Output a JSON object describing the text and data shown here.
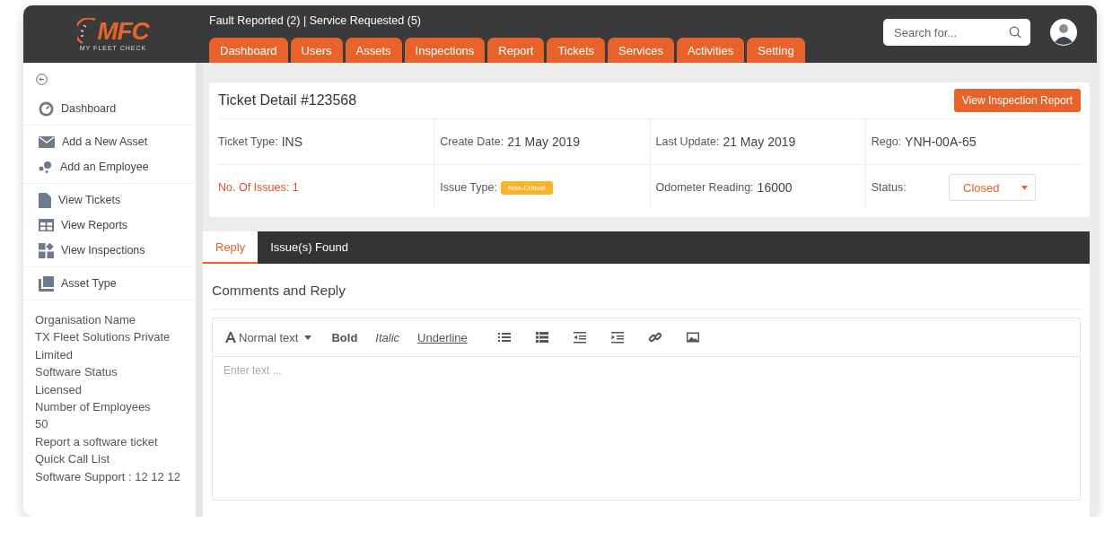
{
  "logo": {
    "text": "MFC",
    "caption": "MY FLEET CHECK"
  },
  "header": {
    "notice": "Fault Reported (2) | Service Requested (5)",
    "tabs": [
      {
        "label": "Dashboard",
        "selected": false
      },
      {
        "label": "Users",
        "selected": false
      },
      {
        "label": "Assets",
        "selected": false
      },
      {
        "label": "Inspections",
        "selected": false
      },
      {
        "label": "Report",
        "selected": false
      },
      {
        "label": "Tickets",
        "selected": false
      },
      {
        "label": "Services",
        "selected": false
      },
      {
        "label": "Activities",
        "selected": false
      },
      {
        "label": "Setting",
        "selected": false
      }
    ],
    "search": {
      "placeholder": "Search for..."
    }
  },
  "sidebar": {
    "groups": [
      {
        "items": [
          {
            "label": "Dashboard"
          }
        ]
      },
      {
        "items": [
          {
            "label": "Add a New Asset"
          },
          {
            "label": "Add an Employee"
          }
        ]
      },
      {
        "items": [
          {
            "label": "View Tickets"
          },
          {
            "label": "View Reports"
          },
          {
            "label": "View Inspections"
          }
        ]
      },
      {
        "items": [
          {
            "label": "Asset Type"
          }
        ]
      }
    ],
    "info": [
      "Organisation Name",
      "TX Fleet Solutions Private Limited",
      "Software Status",
      "Licensed",
      "Number of Employees",
      "50",
      "Report a software ticket",
      "Quick Call List",
      "Software Support : 12 12 12"
    ]
  },
  "ticket": {
    "title": "Ticket Detail #123568",
    "action": "View Inspection Report",
    "rows": [
      [
        {
          "kind": "text",
          "label": "Ticket Type:",
          "value": "INS"
        },
        {
          "kind": "text",
          "label": "Create Date:",
          "value": "21 May 2019"
        },
        {
          "kind": "text",
          "label": "Last Update:",
          "value": "21 May 2019"
        },
        {
          "kind": "text",
          "label": "Rego:",
          "value": "YNH-00A-65"
        }
      ],
      [
        {
          "kind": "alert",
          "label": "No. Of Issues: 1"
        },
        {
          "kind": "badge",
          "label": "Issue Type:",
          "value": "Non-Critical"
        },
        {
          "kind": "text",
          "label": "Odometer Reading:",
          "value": "16000"
        },
        {
          "kind": "select",
          "label": "Status:",
          "value": "Closed"
        }
      ]
    ]
  },
  "reply_tabs": [
    {
      "label": "Reply",
      "selected": true
    },
    {
      "label": "Issue(s) Found",
      "selected": false
    }
  ],
  "comments": {
    "title": "Comments and Reply",
    "format": "Normal text",
    "styles": [
      {
        "label": "Bold",
        "kind": "bold"
      },
      {
        "label": "Italic",
        "kind": "italic"
      },
      {
        "label": "Underline",
        "kind": "underline"
      }
    ],
    "placeholder": "Enter text ..."
  }
}
